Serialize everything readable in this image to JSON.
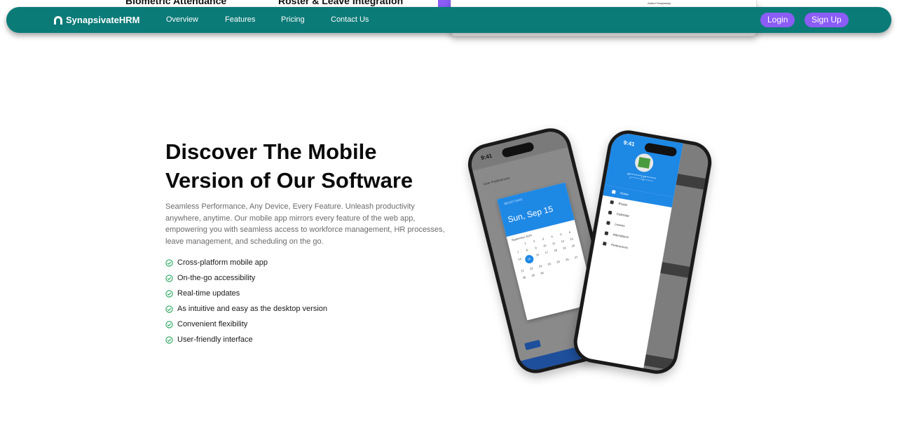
{
  "peek": {
    "left_title": "Biometric Attendance",
    "right_title": "Roster & Leave Integration",
    "card_text": "Added Template(s)"
  },
  "navbar": {
    "brand": "SynapsivateHRM",
    "links": [
      "Overview",
      "Features",
      "Pricing",
      "Contact Us"
    ],
    "login": "Login",
    "signup": "Sign Up"
  },
  "hero": {
    "headline_line1": "Discover The Mobile",
    "headline_line2": "Version of Our Software",
    "description": "Seamless Performance, Any Device, Every Feature. Unleash productivity anywhere, anytime. Our mobile app mirrors every feature of the web app, empowering you with seamless access to workforce management, HR processes, leave management, and scheduling on the go.",
    "features": [
      "Cross-platform mobile app",
      "On-the-go accessibility",
      "Real-time updates",
      "As intuitive and easy as the desktop version",
      "Convenient flexibility",
      "User-friendly interface"
    ]
  },
  "phone_left": {
    "time": "9:41",
    "screen_title": "User Preferences",
    "date_picker": {
      "label": "SELECT DATE",
      "selected": "Sun, Sep 15",
      "month": "September 2024",
      "days": [
        "",
        "1",
        "2",
        "3",
        "4",
        "5",
        "6",
        "7",
        "8",
        "9",
        "10",
        "11",
        "12",
        "13",
        "14",
        "15",
        "16",
        "17",
        "18",
        "19",
        "20",
        "21",
        "22",
        "23",
        "24",
        "25",
        "26",
        "27",
        "28",
        "29",
        "30"
      ]
    }
  },
  "phone_right": {
    "time": "9:41",
    "user_name": "M***********j M**********",
    "user_email": "g**************@***********",
    "menu": [
      "Home",
      "Roster",
      "Calendar",
      "Leaves",
      "Attendance",
      "Preferences"
    ]
  },
  "colors": {
    "navbar": "#0b7b78",
    "accent_purple": "#8b5cf6",
    "check_green": "#22a55b",
    "app_blue": "#1e88e5"
  }
}
